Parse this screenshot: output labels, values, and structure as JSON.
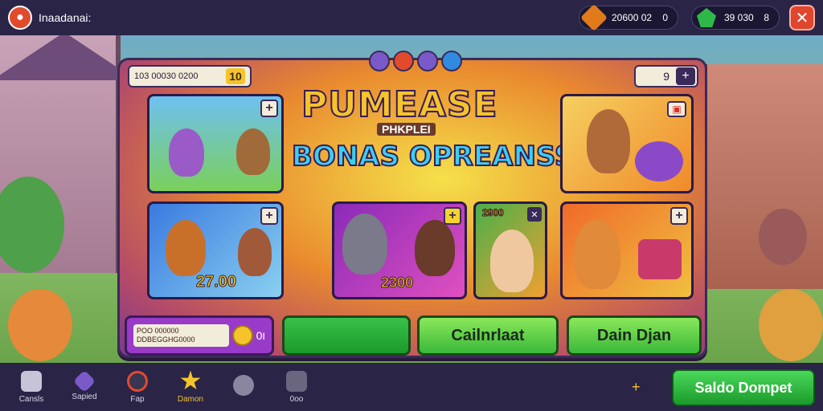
{
  "header": {
    "app_title": "Inaadanai:",
    "currency_1": {
      "value": "20600 02",
      "suffix": "0"
    },
    "currency_2": {
      "value": "39 030",
      "suffix": "8"
    },
    "close_label": "✕"
  },
  "panel": {
    "balance": "103 00030 0200",
    "balance_badge": "10",
    "rank_value": "9",
    "title_main": "PUMEASE",
    "title_sub": "PHKPLEI",
    "title_secondary": "BONAS OPREANSS",
    "cards": [
      {
        "label": ""
      },
      {
        "label": ""
      },
      {
        "label": "27.00"
      },
      {
        "label": "2300"
      },
      {
        "label": "2900"
      },
      {
        "label": ""
      }
    ],
    "promo_text": "POO 000000 DDBEGGHG0000",
    "promo_value": "0ו",
    "buttons": {
      "confirm": "Cailnrlaat",
      "dan": "Dain Djan"
    }
  },
  "bottom_nav": {
    "items": [
      {
        "label": "Cansls"
      },
      {
        "label": "Sapied"
      },
      {
        "label": "Fap"
      },
      {
        "label": "Damon"
      },
      {
        "label": ""
      },
      {
        "label": "0oo"
      }
    ],
    "plus": "+",
    "saldo_button": "Saldo Dompet"
  },
  "colors": {
    "topbar": "#2a2447",
    "accent_green": "#3ab83a",
    "accent_red": "#e24a2e",
    "accent_gold": "#f5c42a"
  }
}
